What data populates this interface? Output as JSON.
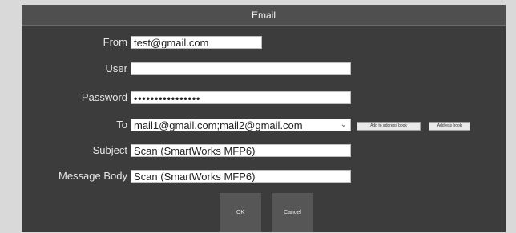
{
  "dialog": {
    "title": "Email",
    "labels": {
      "from": "From",
      "user": "User",
      "password": "Password",
      "to": "To",
      "subject": "Subject",
      "message_body": "Message Body"
    },
    "fields": {
      "from": "test@gmail.com",
      "user": "",
      "password": "••••••••••••••••",
      "to": "mail1@gmail.com;mail2@gmail.com",
      "subject": "Scan (SmartWorks MFP6)",
      "message_body": "Scan (SmartWorks MFP6)"
    },
    "buttons": {
      "add_to_address_book": "Add to address book",
      "address_book": "Address book",
      "ok": "OK",
      "cancel": "Cancel"
    },
    "icons": {
      "to_dropdown": "chevron-down-icon"
    }
  }
}
